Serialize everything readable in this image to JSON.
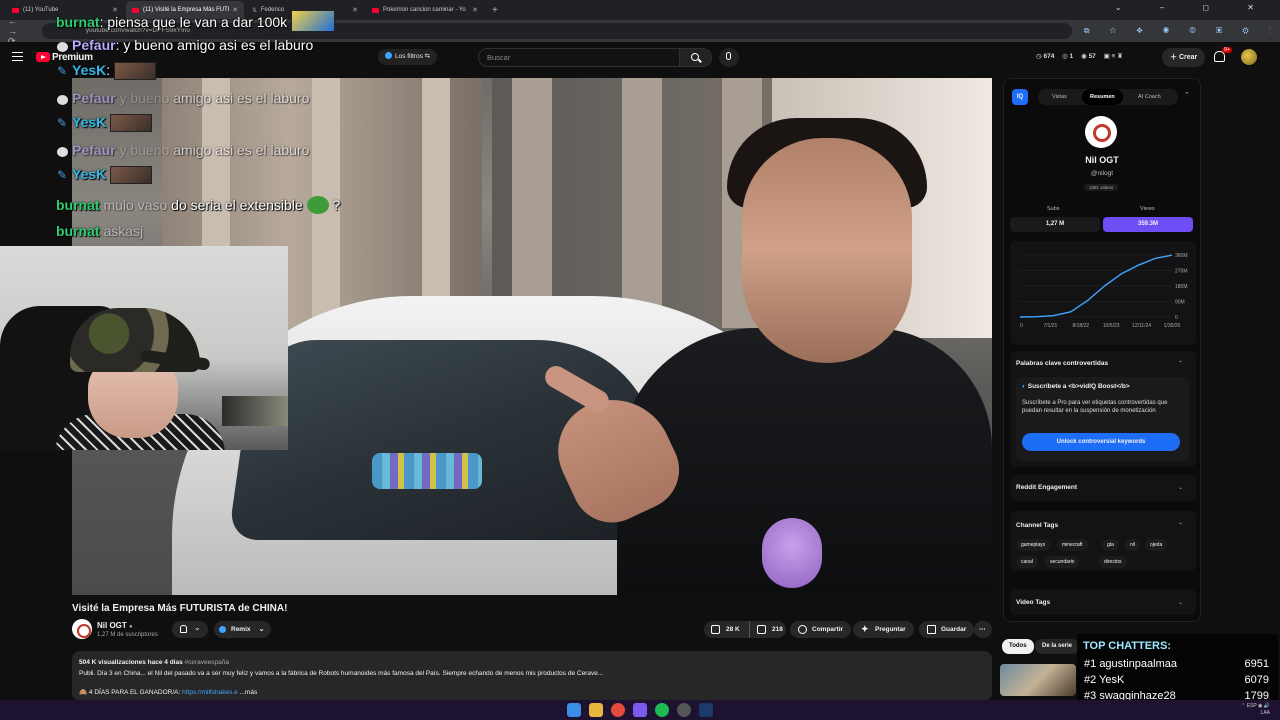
{
  "browser": {
    "tabs": [
      {
        "title": "(11) YouTube"
      },
      {
        "title": "(11) Visité la Empresa Más FUTI"
      },
      {
        "title": "Federico"
      },
      {
        "title": "Pokemon cancion caminar - Yo"
      }
    ],
    "url": "youtube.com/watch?v=DPFS9kYIno"
  },
  "header": {
    "brand": "Premium",
    "filters_label": "Los filtros",
    "search_placeholder": "Buscar",
    "stats": [
      "674",
      "1",
      "57"
    ],
    "create_label": "Crear",
    "notif_count": "9+"
  },
  "chat": [
    {
      "user": "burnat",
      "text": ": piensa que le van a dar 100k"
    },
    {
      "user": "Pefaur",
      "text": ": y bueno amigo asi es el laburo"
    },
    {
      "user": "YesK",
      "text": ":"
    },
    {
      "user": "Pefaur",
      "text": "amigo asi es el laburo"
    },
    {
      "user": "YesK",
      "text": ""
    },
    {
      "user": "Pefaur",
      "text": "amigo asi es el laburo"
    },
    {
      "user": "YesK",
      "text": ""
    },
    {
      "user": "burnat",
      "text": "do seria el extensible",
      "suffix": "?"
    },
    {
      "user": "burnat",
      "text": ""
    }
  ],
  "video": {
    "title": "Visité la Empresa Más FUTURISTA de CHINA!",
    "channel": "Nil OGT",
    "subscribers": "1,27 M de suscriptores",
    "remix_label": "Remix",
    "likes": "28 K",
    "dislikes": "218",
    "share_label": "Compartir",
    "ask_label": "Preguntar",
    "save_label": "Guardar",
    "views_meta": "504 K visualizaciones  hace 4 días",
    "hashtag": "#ceraveespaña",
    "description": "Publi. Día 3 en China... el Nil del pasado va a ser muy feliz y vamos a la fábrica de Robots humanoides más famosa del País. Siempre echando de menos mis productos de Cerave...",
    "desc_line2_prefix": "4 DÍAS PARA EL GANADOR/A: ",
    "desc_link": "https://milfshakes.e",
    "desc_more": " ...más"
  },
  "panel": {
    "tabs": [
      "Vistas",
      "Resumen",
      "AI Coach"
    ],
    "channel_name": "Nil OGT",
    "handle": "@nilogt",
    "videos": "1081 videos",
    "subs_label": "Subs",
    "views_label": "Views",
    "subs_value": "1,27 M",
    "views_value": "359.3M",
    "keywords_title": "Palabras clave controvertidas",
    "boost_title": "Suscríbete a <b>vidIQ Boost</b>",
    "boost_text": "Suscríbete a Pro para ver etiquetas controvertidas que puedan resultar en la suspensión de monetización",
    "unlock_label": "Unlock controversial keywords",
    "reddit_title": "Reddit Engagement",
    "channel_tags_title": "Channel Tags",
    "channel_tags": [
      "gameplays",
      "minecraft",
      "gta",
      "nil",
      "ojeda",
      "canal",
      "secundario",
      "directos"
    ],
    "video_tags_title": "Video Tags"
  },
  "chart_data": {
    "type": "line",
    "x": [
      "0",
      "7/1/21",
      "8/18/22",
      "10/5/23",
      "12/11/24",
      "1/30/26"
    ],
    "yticks": [
      "0",
      "90M",
      "180M",
      "270M",
      "360M"
    ],
    "series": [
      {
        "values": [
          0,
          2,
          8,
          30,
          95,
          180,
          250,
          300,
          340,
          359
        ]
      }
    ],
    "ylim": [
      0,
      360
    ]
  },
  "related": {
    "chips": [
      "Todos",
      "De la serie"
    ]
  },
  "top_chatters": {
    "title": "TOP CHATTERS:",
    "rows": [
      {
        "rank": "#1",
        "name": "agustinpaalmaa",
        "count": "6951"
      },
      {
        "rank": "#2",
        "name": "YesK",
        "count": "6079"
      },
      {
        "rank": "#3",
        "name": "swagginhaze28",
        "count": "1799"
      }
    ]
  },
  "colors": {
    "accent": "#1e6df6",
    "views_pill": "#6f4df5",
    "chart_line": "#3ea6ff",
    "chat_green": "#2ecc71"
  }
}
